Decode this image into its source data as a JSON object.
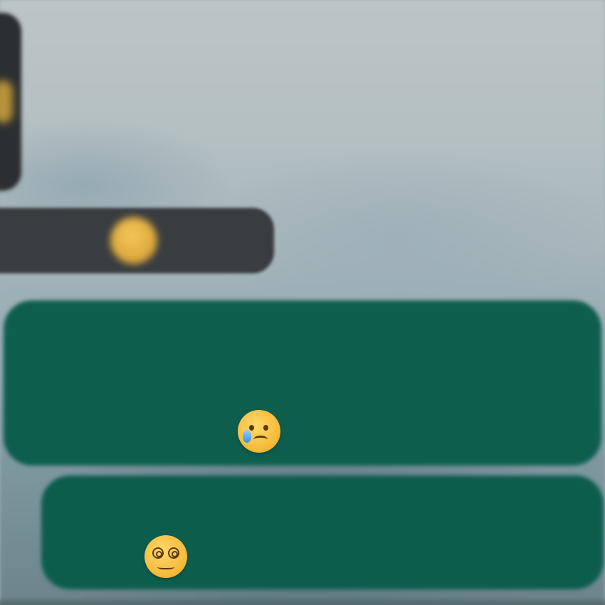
{
  "colors": {
    "wallpaper_top": "#bcc4c6",
    "wallpaper_bottom": "#6c858c",
    "received_bubble": "#3a3d40",
    "sent_bubble": "#0e5e4e",
    "text_on_sent": "#d7e3df"
  },
  "messages": [
    {
      "direction": "received",
      "text": "",
      "emoji_icon": "beaming-face-emoji"
    },
    {
      "direction": "sent",
      "text_lines": [
        "",
        "",
        ""
      ],
      "emoji_icon": "face-holding-back-tears-emoji"
    },
    {
      "direction": "sent",
      "text_lines": [
        "",
        ""
      ],
      "emoji_icon": "face-with-spiral-eyes-emoji"
    }
  ]
}
